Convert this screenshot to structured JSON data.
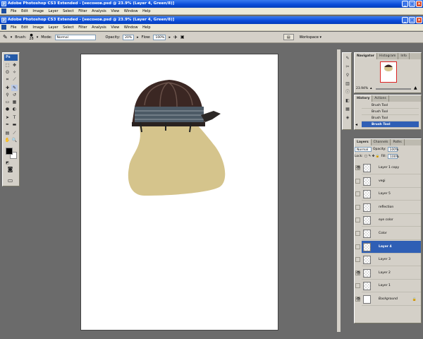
{
  "app": {
    "outer_title": "Adobe Photoshop CS3 Extended - [несонов.psd @ 23.9% (Layer 4, Green/8)]",
    "inner_title": "Adobe Photoshop CS3 Extended - [несонов.psd @ 23.9% (Layer 4, Green/8)]",
    "app_icon": "photoshop-icon"
  },
  "menu": [
    "File",
    "Edit",
    "Image",
    "Layer",
    "Select",
    "Filter",
    "Analysis",
    "View",
    "Window",
    "Help"
  ],
  "options": {
    "brush_label": "Brush:",
    "brush_size": "28",
    "mode_label": "Mode:",
    "mode_value": "Normal",
    "opacity_label": "Opacity:",
    "opacity_value": "20%",
    "flow_label": "Flow:",
    "flow_value": "100%",
    "workspace_label": "Workspace ▾"
  },
  "toolbox": {
    "logo": "Ps",
    "foreground": "#000000",
    "background": "#ffffff"
  },
  "navigator": {
    "tabs": [
      "Navigator",
      "Histogram",
      "Info"
    ],
    "zoom": "23.94%"
  },
  "history": {
    "tabs": [
      "History",
      "Actions"
    ],
    "items": [
      "Brush Tool",
      "Brush Tool",
      "Brush Tool",
      "Brush Tool"
    ],
    "selected_index": 3
  },
  "layers": {
    "tabs": [
      "Layers",
      "Channels",
      "Paths"
    ],
    "blend_mode": "Normal",
    "opacity_label": "Opacity:",
    "opacity_value": "100%",
    "lock_label": "Lock:",
    "fill_label": "Fill:",
    "fill_value": "100%",
    "items": [
      {
        "name": "Layer 1 copy",
        "visible": true
      },
      {
        "name": "vegi",
        "visible": false
      },
      {
        "name": "Layer 5",
        "visible": false
      },
      {
        "name": "reflection",
        "visible": false
      },
      {
        "name": "eye color",
        "visible": false
      },
      {
        "name": "Color",
        "visible": false
      },
      {
        "name": "Layer 4",
        "visible": false,
        "selected": true
      },
      {
        "name": "Layer 3",
        "visible": false
      },
      {
        "name": "Layer 2",
        "visible": true
      },
      {
        "name": "Layer 1",
        "visible": false
      },
      {
        "name": "Background",
        "visible": true,
        "locked": true
      }
    ]
  },
  "colors": {
    "xp_blue": "#0a4bd8",
    "panel": "#d4d0c8",
    "selection": "#2f5fb5",
    "skin": "#d5c48c",
    "dome_dark": "#3b2723"
  }
}
